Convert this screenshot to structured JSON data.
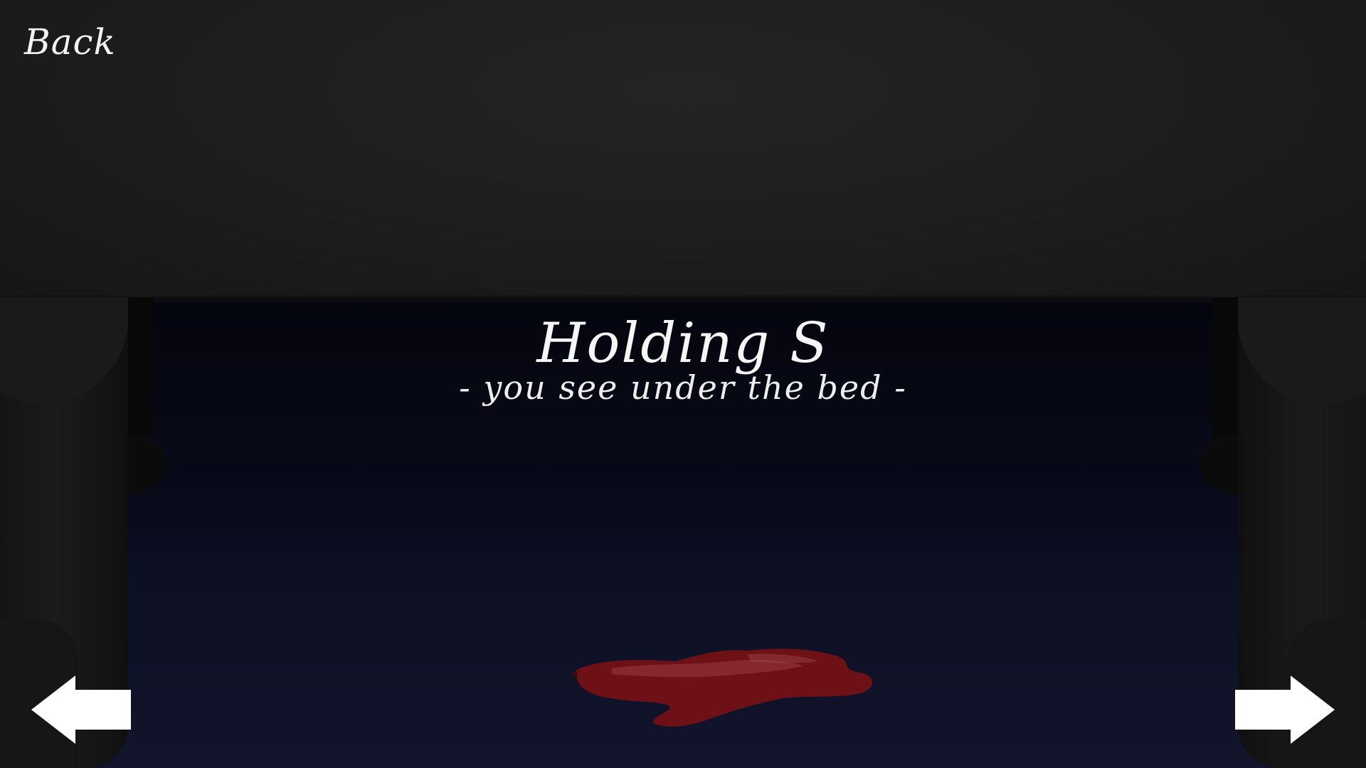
{
  "navigation": {
    "back_label": "Back"
  },
  "scene": {
    "title": "Holding S",
    "subtitle": "- you see under the bed -"
  },
  "icons": {
    "previous": "arrow-left-icon",
    "next": "arrow-right-icon"
  },
  "colors": {
    "text": "#f6f6f6",
    "blood": "#7a1218",
    "floor": "#0d0f24",
    "bed": "#1d1d1d"
  }
}
